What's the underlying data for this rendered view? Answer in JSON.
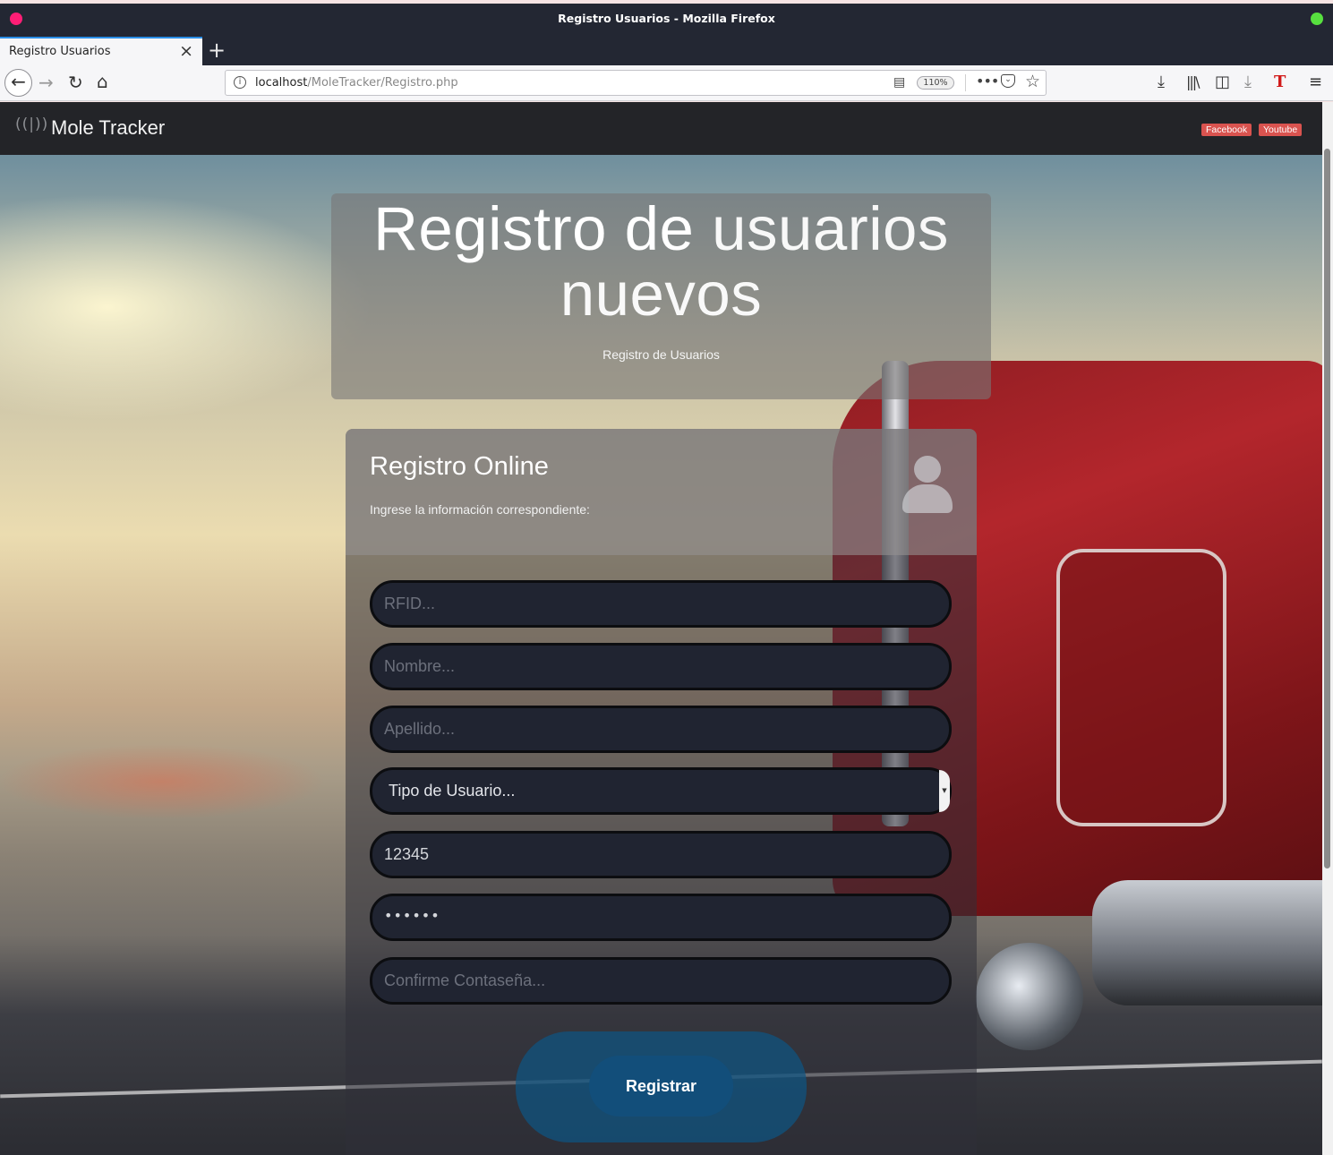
{
  "window": {
    "title": "Registro Usuarios - Mozilla Firefox"
  },
  "tabs": [
    {
      "label": "Registro Usuarios",
      "active": true
    }
  ],
  "toolbar": {
    "url_host": "localhost",
    "url_path": "/MoleTracker/Registro.php",
    "zoom": "110%",
    "more_label": "•••"
  },
  "site": {
    "brand": "Mole Tracker",
    "social": {
      "facebook": "Facebook",
      "youtube": "Youtube"
    }
  },
  "hero": {
    "title_bold": "Registro de",
    "title_light": "usuarios nuevos",
    "subtitle": "Registro de Usuarios"
  },
  "form": {
    "title": "Registro Online",
    "hint": "Ingrese la información correspondiente:",
    "fields": {
      "rfid_placeholder": "RFID...",
      "nombre_placeholder": "Nombre...",
      "apellido_placeholder": "Apellido...",
      "tipo_selected": "Tipo de Usuario...",
      "code_value": "12345",
      "password_value": "••••••",
      "confirm_placeholder": "Confirme Contaseña..."
    },
    "submit_label": "Registrar"
  },
  "colors": {
    "accent_tab": "#2a8ee6",
    "social_badge": "#d9534f",
    "register_button": "#124e7a",
    "field_bg": "#202431"
  },
  "icons": [
    "close-window-icon",
    "maximize-window-icon",
    "tab-close-icon",
    "new-tab-icon",
    "back-icon",
    "forward-icon",
    "reload-icon",
    "home-icon",
    "site-info-icon",
    "reader-view-icon",
    "page-actions-icon",
    "pocket-icon",
    "bookmark-star-icon",
    "downloads-icon",
    "library-icon",
    "sidebar-icon",
    "download-arrow-icon",
    "t-extension-icon",
    "hamburger-menu-icon",
    "broadcast-icon",
    "user-icon"
  ]
}
